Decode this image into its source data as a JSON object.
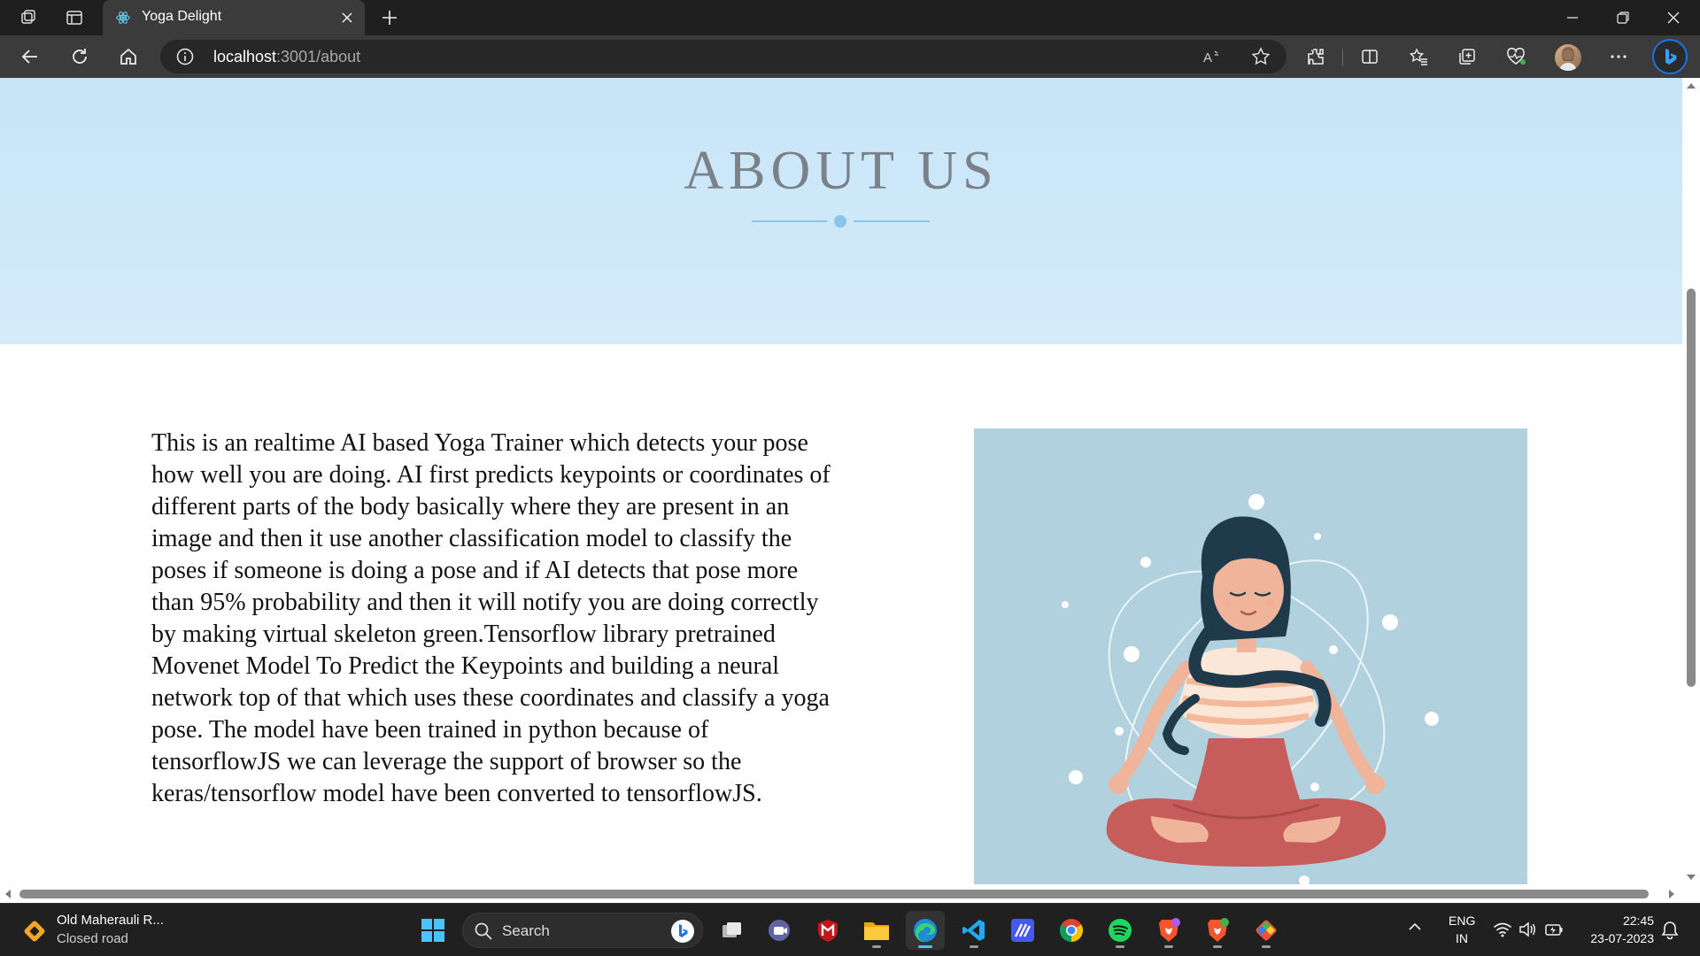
{
  "browser": {
    "tab_title": "Yoga Delight",
    "url_host": "localhost",
    "url_path": ":3001/about"
  },
  "page": {
    "hero_title": "ABOUT US",
    "about_text": "This is an realtime AI based Yoga Trainer which detects your pose how well you are doing. AI first predicts keypoints or coordinates of different parts of the body basically where they are present in an image and then it use another classification model to classify the poses if someone is doing a pose and if AI detects that pose more than 95% probability and then it will notify you are doing correctly by making virtual skeleton green.Tensorflow library pretrained Movenet Model To Predict the Keypoints and building a neural network top of that which uses these coordinates and classify a yoga pose. The model have been trained in python because of tensorflowJS we can leverage the support of browser so the keras/tensorflow model have been converted to tensorflowJS.",
    "hero_color": "#c7e5f8",
    "accent_color": "#8ac4e6",
    "image_bg_color": "#b1d1de"
  },
  "taskbar": {
    "weather_title": "Old Maherauli R...",
    "weather_subtitle": "Closed road",
    "search_placeholder": "Search",
    "lang_line1": "ENG",
    "lang_line2": "IN",
    "time": "22:45",
    "date": "23-07-2023"
  },
  "icons": [
    "workspaces-icon",
    "tab-actions-icon",
    "react-favicon-icon",
    "close-icon",
    "plus-icon",
    "minimize-icon",
    "restore-icon",
    "back-icon",
    "refresh-icon",
    "home-icon",
    "info-icon",
    "read-aloud-icon",
    "star-icon",
    "extensions-icon",
    "split-screen-icon",
    "favorites-icon",
    "collections-icon",
    "health-icon",
    "more-icon",
    "bing-icon",
    "windows-icon",
    "search-icon",
    "task-view-icon",
    "teams-icon",
    "mcafee-icon",
    "file-explorer-icon",
    "edge-icon",
    "vscode-icon",
    "tracker-icon",
    "chrome-icon",
    "spotify-icon",
    "brave-icon",
    "brave-beta-icon",
    "git-icon",
    "chevron-up-icon",
    "wifi-icon",
    "volume-icon",
    "battery-icon",
    "notification-icon"
  ]
}
